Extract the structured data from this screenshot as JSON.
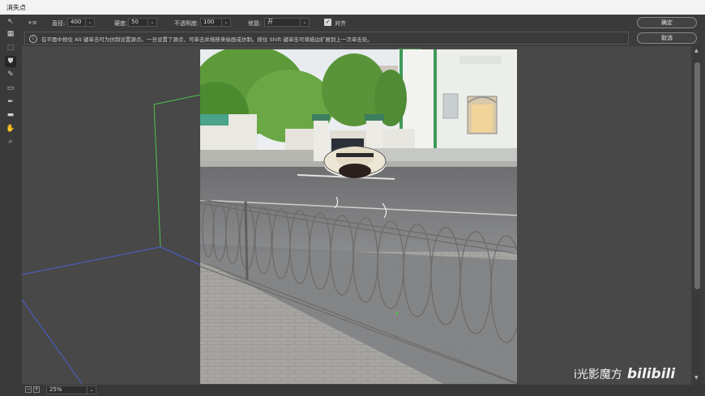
{
  "window": {
    "title": "消失点"
  },
  "options": {
    "brush_icon_label": "+≡",
    "diameter_label": "直径:",
    "diameter_value": "400",
    "hardness_label": "硬度:",
    "hardness_value": "50",
    "opacity_label": "不透明度:",
    "opacity_value": "100",
    "heal_label": "修复:",
    "heal_value": "开",
    "aligned_label": "对齐",
    "aligned_checked": true
  },
  "info": {
    "icon": "info-icon",
    "text": "在平面中按住 Alt 键单击可为仿制设置源点。一旦设置了源点，可单击并拖移来绘画或仿制。按住 Shift 键单击可将描边扩展到上一次单击处。"
  },
  "buttons": {
    "ok": "确定",
    "cancel": "取消"
  },
  "tools": [
    {
      "name": "edit-plane-tool",
      "icon": "arrow-icon",
      "glyph": "↖"
    },
    {
      "name": "create-plane-tool",
      "icon": "grid-plane-icon",
      "glyph": "▦"
    },
    {
      "name": "marquee-tool",
      "icon": "marquee-icon",
      "glyph": "⬚"
    },
    {
      "name": "stamp-tool",
      "icon": "stamp-icon",
      "glyph": "⛊",
      "active": true
    },
    {
      "name": "brush-tool",
      "icon": "brush-icon",
      "glyph": "✎"
    },
    {
      "name": "transform-tool",
      "icon": "transform-icon",
      "glyph": "▭"
    },
    {
      "name": "eyedropper-tool",
      "icon": "eyedropper-icon",
      "glyph": "✒"
    },
    {
      "name": "measure-tool",
      "icon": "ruler-icon",
      "glyph": "▬"
    },
    {
      "name": "hand-tool",
      "icon": "hand-icon",
      "glyph": "✋"
    },
    {
      "name": "zoom-tool",
      "icon": "magnifier-icon",
      "glyph": "⌕"
    }
  ],
  "status": {
    "zoom": "25%"
  },
  "watermark": {
    "text": "i光影魔方",
    "logo": "bilibili"
  },
  "colors": {
    "plane_green": "#4ec24e",
    "plane_blue": "#4a5fd0",
    "ui_bg": "#3c3c3c",
    "canvas_bg": "#484848"
  }
}
